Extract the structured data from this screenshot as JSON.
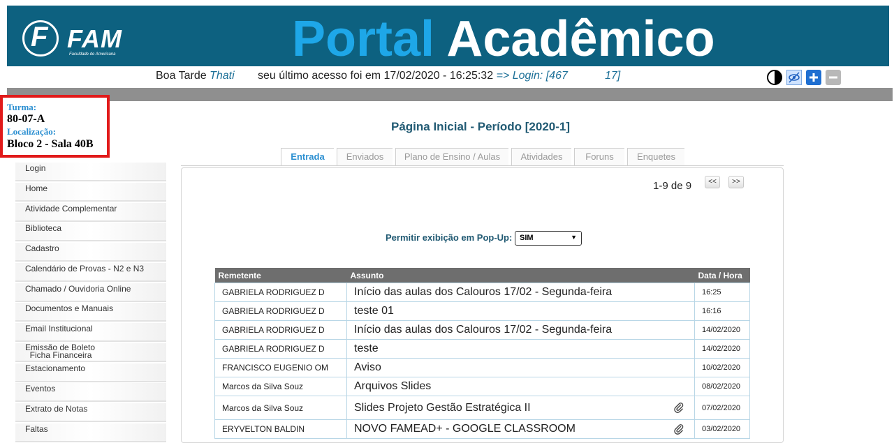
{
  "header": {
    "logo_text": "FAM",
    "logo_sub": "Faculdade de Americana",
    "title_part1": "Portal",
    "title_part2": "Acadêmico"
  },
  "greeting": {
    "salutation": "Boa Tarde",
    "name": "Thati",
    "last_access": "seu último acesso foi em 17/02/2020 - 16:25:32",
    "login_prefix": "=> Login: [467",
    "login_suffix": "17]"
  },
  "accessibility": [
    "contrast-icon",
    "hide-icon",
    "zoom-in-icon",
    "zoom-out-icon"
  ],
  "class_info": {
    "turma_label": "Turma:",
    "turma_value": "80-07-A",
    "local_label": "Localização:",
    "local_value": "Bloco 2 - Sala 40B"
  },
  "sidebar": {
    "items": [
      {
        "label": "Login"
      },
      {
        "label": "Home"
      },
      {
        "label": "Atividade Complementar"
      },
      {
        "label": "Biblioteca"
      },
      {
        "label": "Cadastro"
      },
      {
        "label": "Calendário de Provas - N2 e N3"
      },
      {
        "label": "Chamado / Ouvidoria Online"
      },
      {
        "label": "Documentos e Manuais"
      },
      {
        "label": "Email Institucional"
      },
      {
        "label": "Emissão de Boleto\n  Ficha Financeira"
      },
      {
        "label": "Estacionamento"
      },
      {
        "label": "Eventos"
      },
      {
        "label": "Extrato de Notas"
      },
      {
        "label": "Faltas"
      }
    ]
  },
  "main": {
    "page_title": "Página Inicial - Período [2020-1]",
    "tabs": [
      {
        "label": "Entrada",
        "active": true
      },
      {
        "label": "Enviados"
      },
      {
        "label": "Plano de Ensino / Aulas"
      },
      {
        "label": "Atividades"
      },
      {
        "label": "Foruns"
      },
      {
        "label": "Enquetes"
      }
    ],
    "pager": {
      "text": "1-9 de 9",
      "prev": "<<",
      "next": ">>"
    },
    "popup": {
      "label": "Permitir exibição em Pop-Up:",
      "value": "SIM",
      "arrow": "▼"
    },
    "table": {
      "headers": [
        "Remetente",
        "Assunto",
        "Data / Hora"
      ],
      "rows": [
        {
          "sender": "GABRIELA RODRIGUEZ D",
          "subject": "Início das aulas dos Calouros 17/02 - Segunda-feira",
          "date": "16:25",
          "attach": false
        },
        {
          "sender": "GABRIELA RODRIGUEZ D",
          "subject": "teste 01",
          "date": "16:16",
          "attach": false
        },
        {
          "sender": "GABRIELA RODRIGUEZ D",
          "subject": "Início das aulas dos Calouros 17/02 - Segunda-feira",
          "date": "14/02/2020",
          "attach": false
        },
        {
          "sender": "GABRIELA RODRIGUEZ D",
          "subject": "teste",
          "date": "14/02/2020",
          "attach": false
        },
        {
          "sender": "FRANCISCO EUGENIO OM",
          "subject": "Aviso",
          "date": "10/02/2020",
          "attach": false
        },
        {
          "sender": "Marcos da Silva Souz",
          "subject": "Arquivos Slides",
          "date": "08/02/2020",
          "attach": false
        },
        {
          "sender": "Marcos da Silva Souz",
          "subject": "Slides Projeto Gestão Estratégica II",
          "date": "07/02/2020",
          "attach": true
        },
        {
          "sender": "ERYVELTON BALDIN",
          "subject": "NOVO FAMEAD+ - GOOGLE CLASSROOM",
          "date": "03/02/2020",
          "attach": true
        }
      ]
    }
  },
  "colors": {
    "header_bg": "#0d6180",
    "portal_blue": "#1ea7e8",
    "highlight_red": "#e11a1a"
  }
}
